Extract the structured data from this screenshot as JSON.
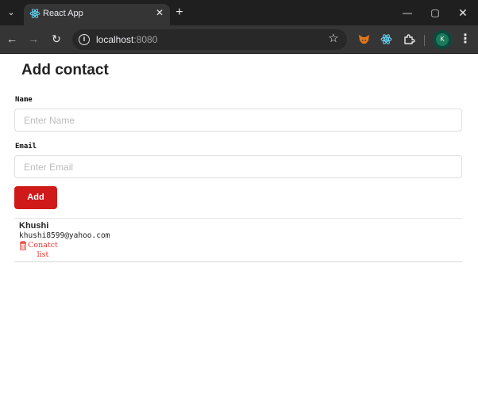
{
  "browser": {
    "tab": {
      "title": "React App",
      "favicon": "react-logo-icon"
    },
    "address": {
      "host": "localhost",
      "port": ":8080"
    },
    "extensions": [
      "metamask-fox-icon",
      "react-devtools-icon",
      "puzzle-icon"
    ],
    "profile_initial": "K"
  },
  "form": {
    "title": "Add contact",
    "name_label": "Name",
    "name_placeholder": "Enter Name",
    "email_label": "Email",
    "email_placeholder": "Enter Email",
    "add_label": "Add"
  },
  "contacts": [
    {
      "name": "Khushi",
      "email": "khushi8599@yahoo.com",
      "action_label": "Conatct list"
    }
  ],
  "colors": {
    "add_button": "#d01919",
    "delete_text": "#e53935",
    "chrome_dark": "#1f1f1f",
    "chrome_toolbar": "#353535"
  }
}
